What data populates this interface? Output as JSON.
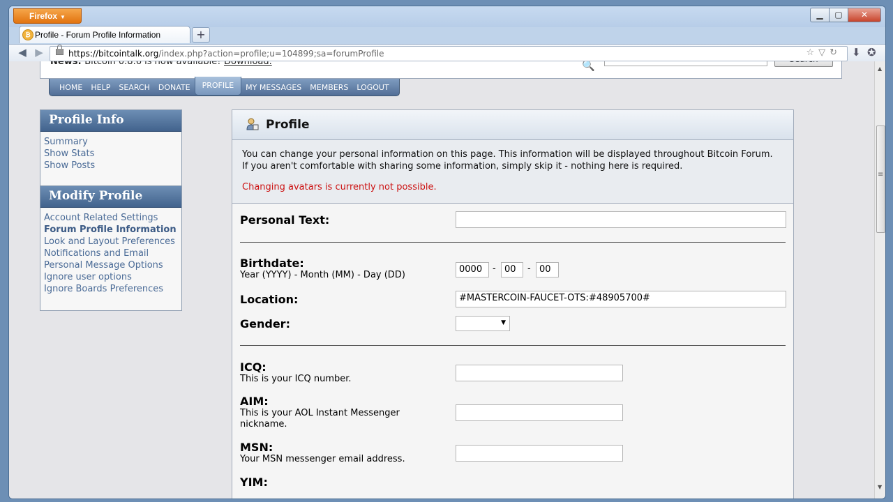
{
  "browser": {
    "app_button": "Firefox",
    "tab_title": "Profile - Forum Profile Information",
    "url_host": "https://bitcointalk.org",
    "url_path": "/index.php?action=profile;u=104899;sa=forumProfile"
  },
  "header": {
    "news_label": "News:",
    "news_text": "Bitcoin 0.8.6 is now available!",
    "news_link": "Download.",
    "search_button": "Search"
  },
  "menu": {
    "items": [
      "HOME",
      "HELP",
      "SEARCH",
      "DONATE",
      "PROFILE",
      "MY MESSAGES",
      "MEMBERS",
      "LOGOUT"
    ],
    "active": "PROFILE"
  },
  "sidebar": {
    "profile_info": {
      "title": "Profile Info",
      "links": [
        "Summary",
        "Show Stats",
        "Show Posts"
      ]
    },
    "modify_profile": {
      "title": "Modify Profile",
      "links": [
        "Account Related Settings",
        "Forum Profile Information",
        "Look and Layout Preferences",
        "Notifications and Email",
        "Personal Message Options",
        "Ignore user options",
        "Ignore Boards Preferences"
      ],
      "current": "Forum Profile Information"
    }
  },
  "profile": {
    "title": "Profile",
    "intro_line1": "You can change your personal information on this page. This information will be displayed throughout Bitcoin Forum.",
    "intro_line2": "If you aren't comfortable with sharing some information, simply skip it - nothing here is required.",
    "warning": "Changing avatars is currently not possible.",
    "fields": {
      "personal_text": {
        "label": "Personal Text:",
        "value": ""
      },
      "birthdate": {
        "label": "Birthdate:",
        "hint": "Year (YYYY) - Month (MM) - Day (DD)",
        "year": "0000",
        "month": "00",
        "day": "00",
        "separator": "-"
      },
      "location": {
        "label": "Location:",
        "value": "#MASTERCOIN-FAUCET-OTS:#48905700#"
      },
      "gender": {
        "label": "Gender:",
        "value": ""
      },
      "icq": {
        "label": "ICQ:",
        "hint": "This is your ICQ number.",
        "value": ""
      },
      "aim": {
        "label": "AIM:",
        "hint": "This is your AOL Instant Messenger nickname.",
        "value": ""
      },
      "msn": {
        "label": "MSN:",
        "hint": "Your MSN messenger email address.",
        "value": ""
      },
      "yim": {
        "label": "YIM:"
      }
    }
  }
}
